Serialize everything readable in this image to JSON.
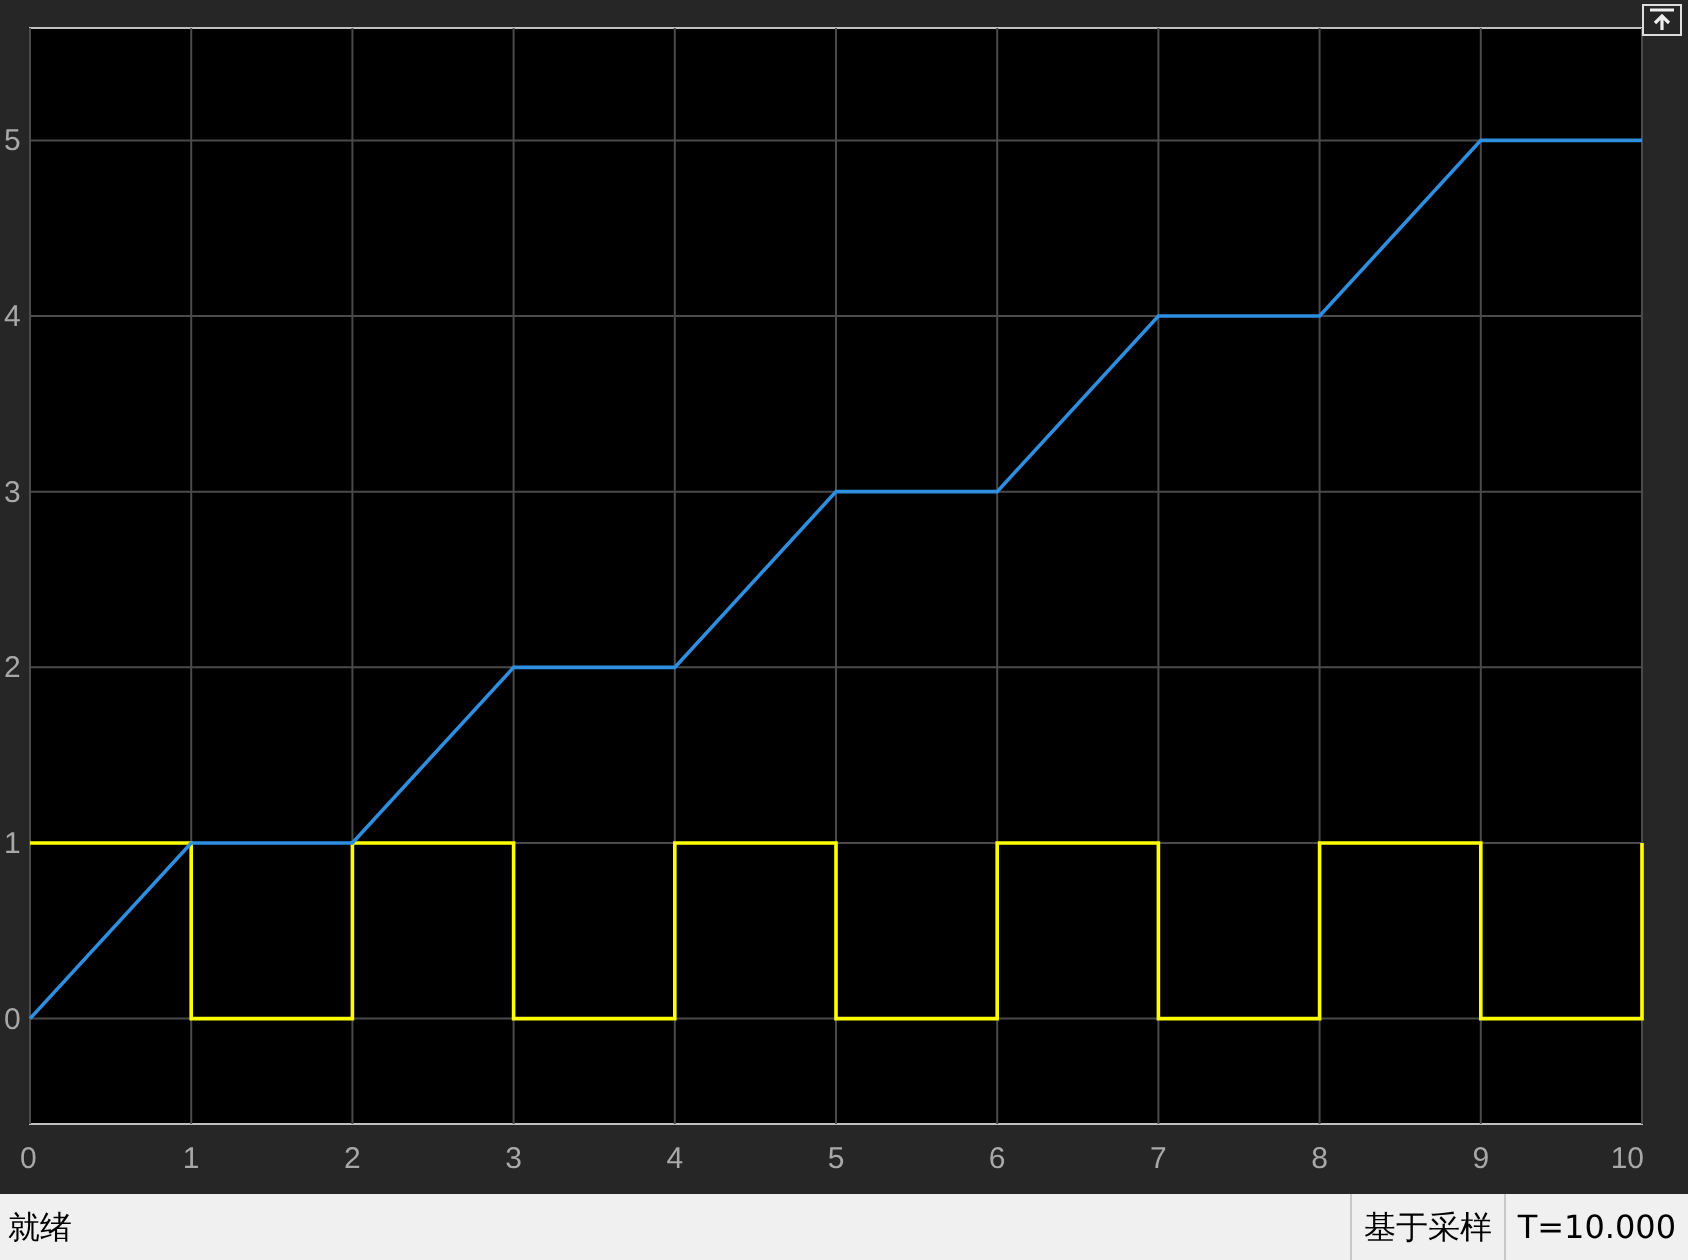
{
  "chart_data": {
    "type": "line",
    "grid": true,
    "x": [
      0,
      1,
      1,
      2,
      2,
      3,
      3,
      4,
      4,
      5,
      5,
      6,
      6,
      7,
      7,
      8,
      8,
      9,
      9,
      10,
      10
    ],
    "xlim": [
      0,
      10
    ],
    "ylim": [
      -0.6,
      5.64
    ],
    "xticks": [
      0,
      1,
      2,
      3,
      4,
      5,
      6,
      7,
      8,
      9,
      10
    ],
    "yticks": [
      0,
      1,
      2,
      3,
      4,
      5
    ],
    "series": [
      {
        "color": "#ffff00",
        "values": [
          1,
          1,
          0,
          0,
          1,
          1,
          0,
          0,
          1,
          1,
          0,
          0,
          1,
          1,
          0,
          0,
          1,
          1,
          0,
          0,
          1
        ]
      },
      {
        "color": "#2e8fe0",
        "values": [
          0,
          1,
          1,
          1,
          1,
          2,
          2,
          2,
          2,
          3,
          3,
          3,
          3,
          4,
          4,
          4,
          4,
          5,
          5,
          5,
          5
        ]
      }
    ]
  },
  "status_bar": {
    "status": "就绪",
    "mode": "基于采样",
    "time": "T=10.000"
  }
}
